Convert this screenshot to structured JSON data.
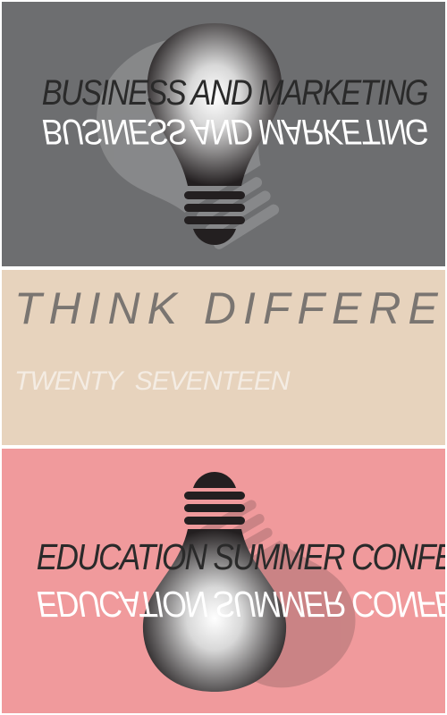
{
  "colors": {
    "page_background": "#ffffff",
    "top_panel": "#6d6e70",
    "middle_panel": "#e7d3bd",
    "bottom_panel": "#f09a9c",
    "bulb_dark": "#231f20",
    "headline_text": "#2a2a2a",
    "mirror_text": "#ffffff",
    "tagline_text": "#7a7571",
    "year_text": "#f4ece3"
  },
  "top_panel": {
    "headline": "BUSINESS AND MARKETING",
    "mirrored_headline": "BUSINESS AND MARKETING",
    "icon": "lightbulb-icon"
  },
  "middle_panel": {
    "tagline": "THINK DIFFERENT.",
    "year": "TWENTY  SEVENTEEN"
  },
  "bottom_panel": {
    "headline": "EDUCATION SUMMER CONFERENCE",
    "mirrored_headline": "EDUCATION SUMMER CONFERENCE",
    "icon": "lightbulb-icon"
  }
}
